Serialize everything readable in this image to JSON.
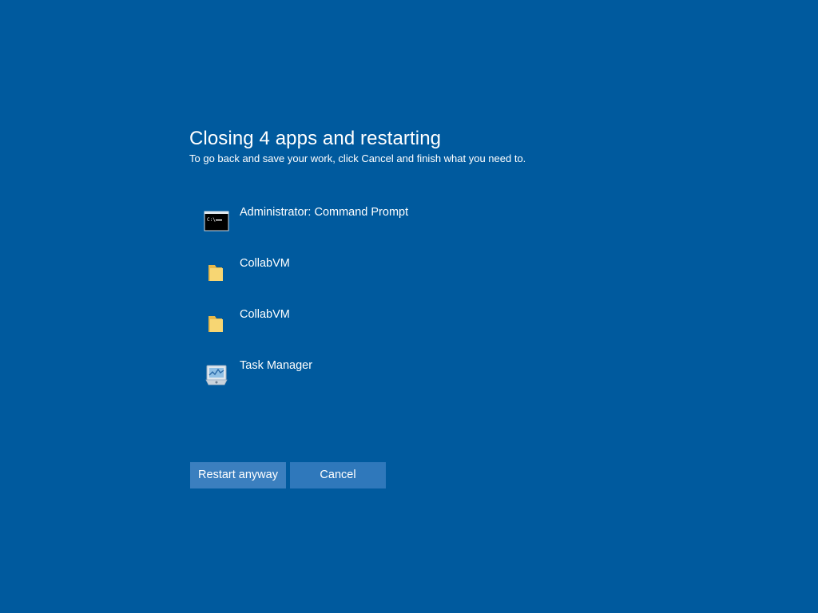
{
  "dialog": {
    "title": "Closing 4 apps and restarting",
    "subtitle": "To go back and save your work, click Cancel and finish what you need to."
  },
  "apps": [
    {
      "label": "Administrator: Command Prompt",
      "icon": "command-prompt-icon"
    },
    {
      "label": "CollabVM",
      "icon": "folder-icon"
    },
    {
      "label": "CollabVM",
      "icon": "folder-icon"
    },
    {
      "label": "Task Manager",
      "icon": "task-manager-icon"
    }
  ],
  "buttons": {
    "restart_label": "Restart anyway",
    "cancel_label": "Cancel"
  },
  "colors": {
    "background": "#005a9e",
    "button": "#3b7fbf",
    "text": "#ffffff"
  }
}
